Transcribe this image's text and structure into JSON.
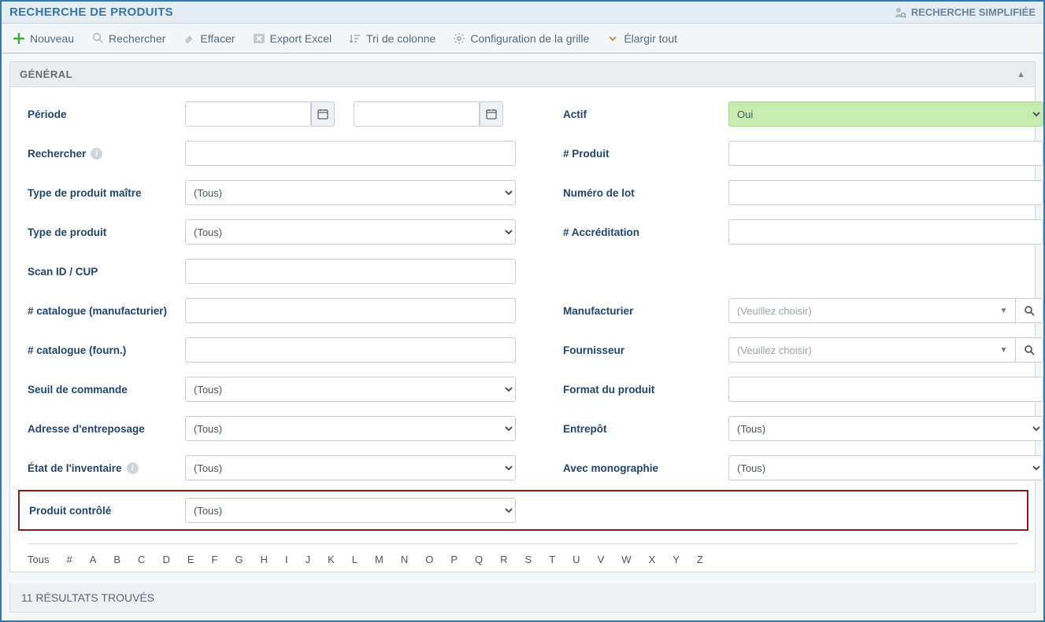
{
  "titleBar": {
    "title": "RECHERCHE DE PRODUITS",
    "simpleSearch": "RECHERCHE SIMPLIFIÉE"
  },
  "toolbar": {
    "nouveau": "Nouveau",
    "rechercher": "Rechercher",
    "effacer": "Effacer",
    "exportExcel": "Export Excel",
    "triColonne": "Tri de colonne",
    "configGrille": "Configuration de la grille",
    "elargirTout": "Élargir tout"
  },
  "panel": {
    "title": "GÉNÉRAL"
  },
  "labels": {
    "periode": "Période",
    "actif": "Actif",
    "rechercher": "Rechercher",
    "numProduit": "# Produit",
    "typeMaitre": "Type de produit maître",
    "numLot": "Numéro de lot",
    "typeProduit": "Type de produit",
    "numAccred": "# Accréditation",
    "scanId": "Scan ID / CUP",
    "catalogueManuf": "# catalogue (manufacturier)",
    "manufacturier": "Manufacturier",
    "catalogueFourn": "# catalogue (fourn.)",
    "fournisseur": "Fournisseur",
    "seuilCommande": "Seuil de commande",
    "formatProduit": "Format du produit",
    "adresseEntrep": "Adresse d'entreposage",
    "entrepot": "Entrepôt",
    "etatInventaire": "État de l'inventaire",
    "avecMono": "Avec monographie",
    "produitControle": "Produit contrôlé"
  },
  "values": {
    "actif": "Oui",
    "tous": "(Tous)",
    "veuillezChoisir": "(Veuillez choisir)"
  },
  "alpha": [
    "Tous",
    "#",
    "A",
    "B",
    "C",
    "D",
    "E",
    "F",
    "G",
    "H",
    "I",
    "J",
    "K",
    "L",
    "M",
    "N",
    "O",
    "P",
    "Q",
    "R",
    "S",
    "T",
    "U",
    "V",
    "W",
    "X",
    "Y",
    "Z"
  ],
  "results": "11 RÉSULTATS TROUVÉS"
}
